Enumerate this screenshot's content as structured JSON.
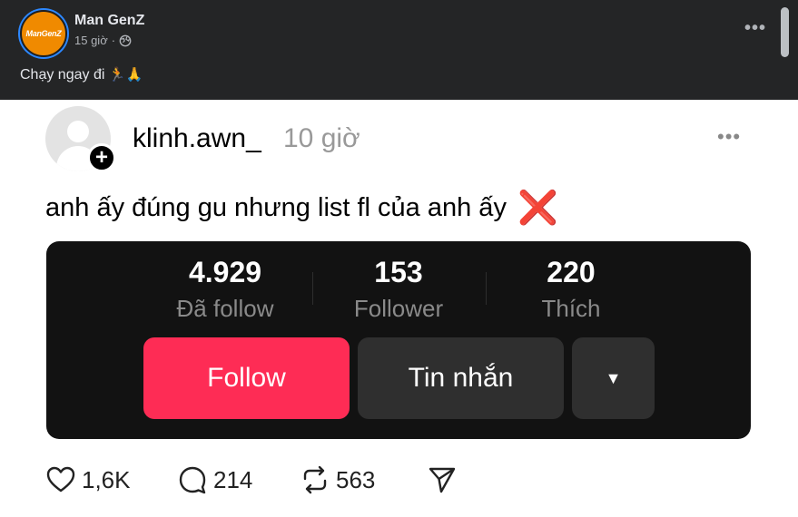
{
  "post": {
    "page_name": "Man GenZ",
    "avatar_text": "ManGenZ",
    "time": "15 giờ",
    "privacy_icon": "globe-icon",
    "caption": "Chạy ngay đi",
    "caption_emoji": "🏃🙏",
    "more_label": "•••"
  },
  "screenshot": {
    "username": "klinh.awn_",
    "time_ago": "10 giờ",
    "more_label": "•••",
    "text": "anh ấy đúng gu nhưng list fl của anh ấy",
    "text_emoji": "❌",
    "stats": [
      {
        "value": "4.929",
        "label": "Đã follow"
      },
      {
        "value": "153",
        "label": "Follower"
      },
      {
        "value": "220",
        "label": "Thích"
      }
    ],
    "buttons": {
      "follow": "Follow",
      "message": "Tin nhắn",
      "dropdown": "▼"
    },
    "actions": {
      "likes": "1,6K",
      "comments": "214",
      "reposts": "563"
    }
  },
  "colors": {
    "follow_button": "#fe2c55",
    "card_bg": "#121212",
    "fb_bg": "#242526"
  }
}
